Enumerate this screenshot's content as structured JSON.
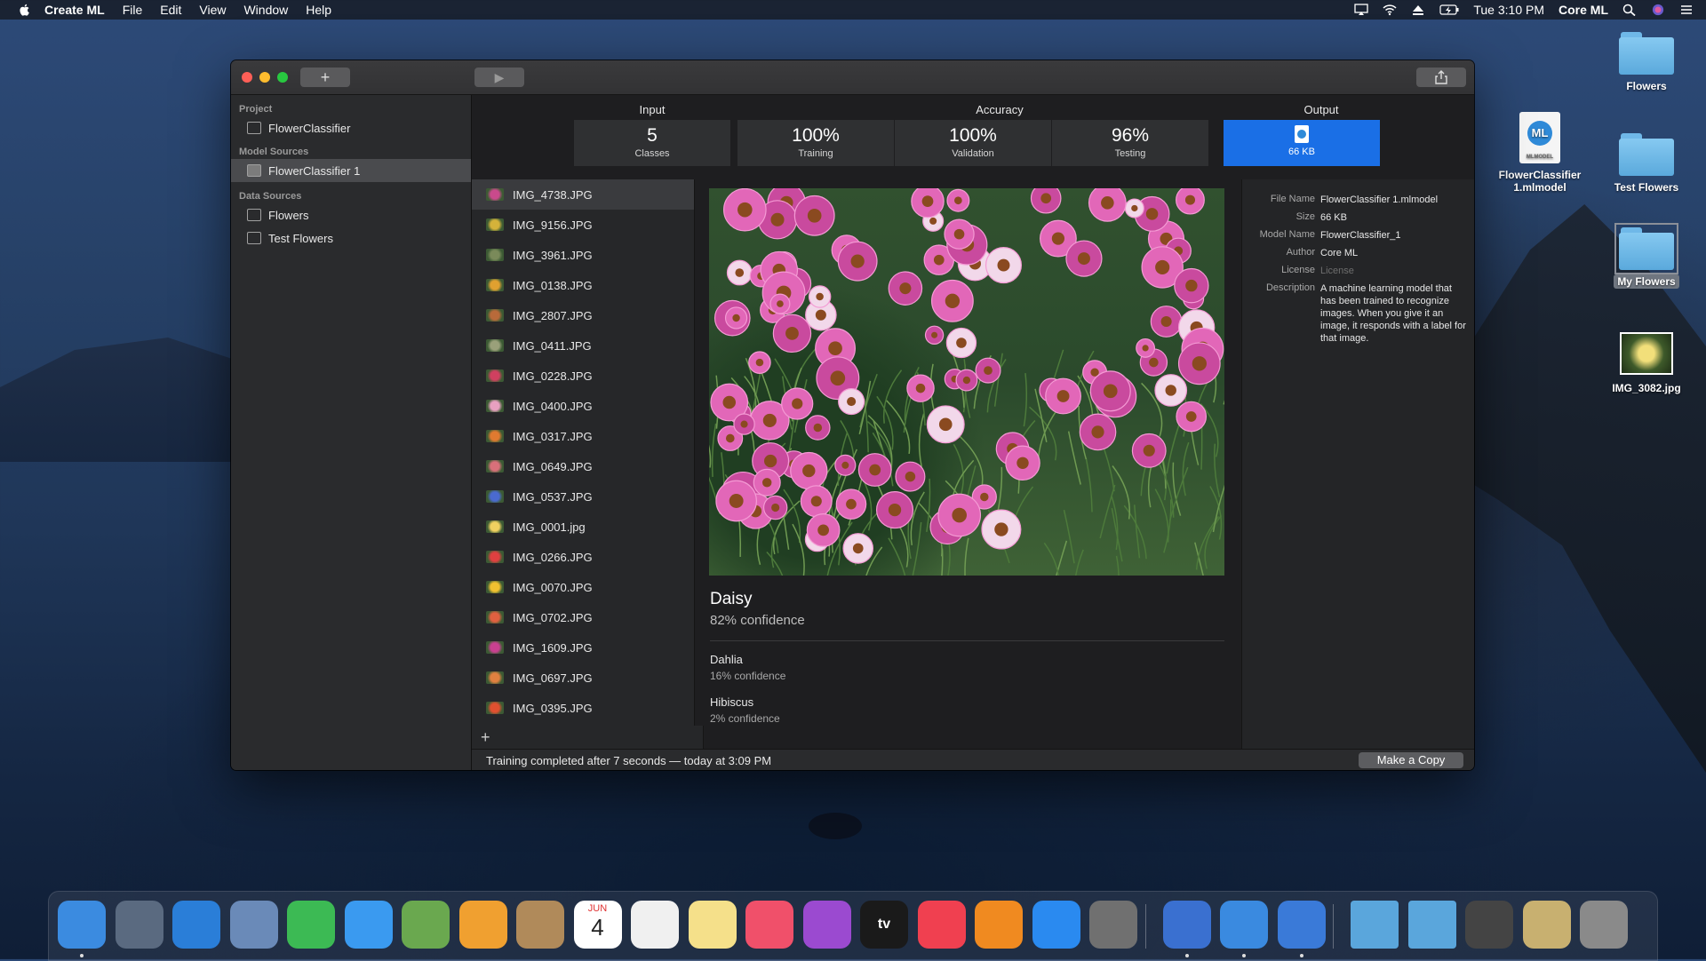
{
  "menubar": {
    "app_name": "Create ML",
    "menus": [
      "File",
      "Edit",
      "View",
      "Window",
      "Help"
    ],
    "clock": "Tue 3:10 PM",
    "user": "Core ML"
  },
  "desktop": {
    "items": [
      {
        "label": "Flowers",
        "type": "folder"
      },
      {
        "label": "FlowerClassifier 1.mlmodel",
        "type": "mlmodel",
        "doc_caption": "MLMODEL"
      },
      {
        "label": "Test Flowers",
        "type": "folder"
      },
      {
        "label": "My Flowers",
        "type": "folder-selected"
      },
      {
        "label": "IMG_3082.jpg",
        "type": "image"
      }
    ]
  },
  "window": {
    "toolbar": {
      "add_label": "+",
      "run_label": "▶"
    },
    "sidebar": {
      "sections": [
        {
          "header": "Project",
          "items": [
            "FlowerClassifier"
          ]
        },
        {
          "header": "Model Sources",
          "items": [
            "FlowerClassifier 1"
          ]
        },
        {
          "header": "Data Sources",
          "items": [
            "Flowers",
            "Test Flowers"
          ]
        }
      ]
    },
    "stats": {
      "input_label": "Input",
      "accuracy_label": "Accuracy",
      "output_label": "Output",
      "classes": {
        "value": "5",
        "label": "Classes"
      },
      "training": {
        "value": "100%",
        "label": "Training"
      },
      "validation": {
        "value": "100%",
        "label": "Validation"
      },
      "testing": {
        "value": "96%",
        "label": "Testing"
      },
      "output_size": "66 KB"
    },
    "files": [
      "IMG_4738.JPG",
      "IMG_9156.JPG",
      "IMG_3961.JPG",
      "IMG_0138.JPG",
      "IMG_2807.JPG",
      "IMG_0411.JPG",
      "IMG_0228.JPG",
      "IMG_0400.JPG",
      "IMG_0317.JPG",
      "IMG_0649.JPG",
      "IMG_0537.JPG",
      "IMG_0001.jpg",
      "IMG_0266.JPG",
      "IMG_0070.JPG",
      "IMG_0702.JPG",
      "IMG_1609.JPG",
      "IMG_0697.JPG",
      "IMG_0395.JPG"
    ],
    "add_file_label": "+",
    "prediction": {
      "top": {
        "label": "Daisy",
        "confidence": "82% confidence"
      },
      "alternates": [
        {
          "label": "Dahlia",
          "confidence": "16% confidence"
        },
        {
          "label": "Hibiscus",
          "confidence": "2% confidence"
        }
      ]
    },
    "metadata": {
      "file_name": {
        "key": "File Name",
        "value": "FlowerClassifier 1.mlmodel"
      },
      "size": {
        "key": "Size",
        "value": "66 KB"
      },
      "model_name": {
        "key": "Model Name",
        "value": "FlowerClassifier_1"
      },
      "author": {
        "key": "Author",
        "value": "Core ML"
      },
      "license": {
        "key": "License",
        "value": "License"
      },
      "description": {
        "key": "Description",
        "value": "A machine learning model that has been trained to recognize images. When you give it an image, it responds with a label for that image."
      }
    },
    "status": "Training completed after 7 seconds — today at 3:09 PM",
    "make_copy_label": "Make a Copy"
  },
  "colors": {
    "accent": "#1a6fe6",
    "window_bg": "#1f1f21",
    "sidebar_bg": "#2a2b2d"
  },
  "dock": {
    "apps": [
      "finder-icon",
      "launchpad-icon",
      "safari-icon",
      "mail-icon",
      "facetime-icon",
      "messages-icon",
      "maps-icon",
      "photos-icon",
      "contacts-icon",
      "calendar-icon",
      "reminders-icon",
      "notes-icon",
      "music-icon",
      "podcasts-icon",
      "tv-icon",
      "news-icon",
      "books-icon",
      "app-store-icon",
      "system-preferences-icon",
      "xcode-instruments-icon",
      "create-ml-icon",
      "xcode-icon",
      "folder-icon",
      "downloads-icon",
      "screenshot-icon",
      "preview-icon",
      "trash-icon"
    ],
    "calendar_month": "JUN",
    "calendar_day": "4",
    "tv_label": "tv"
  }
}
